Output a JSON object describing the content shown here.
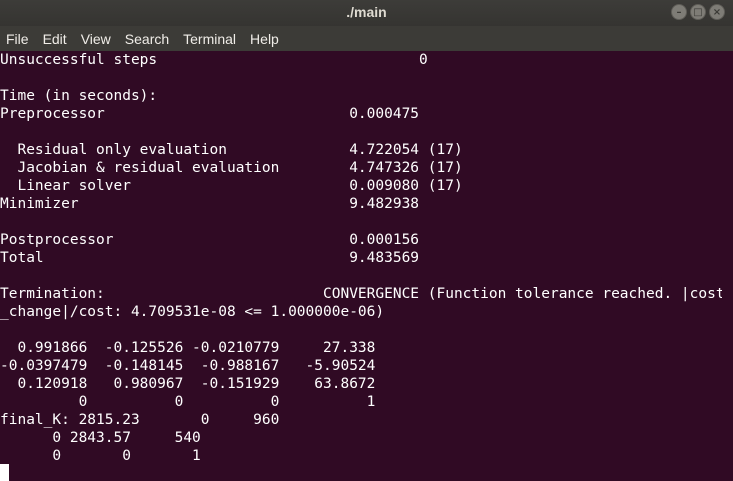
{
  "window": {
    "title": "./main",
    "buttons": {
      "minimize": "–",
      "maximize": "□",
      "close": "×"
    }
  },
  "menu": [
    "File",
    "Edit",
    "View",
    "Search",
    "Terminal",
    "Help"
  ],
  "terminal": {
    "lines": [
      "Unsuccessful steps                              0",
      "",
      "Time (in seconds):",
      "Preprocessor                            0.000475",
      "",
      "  Residual only evaluation              4.722054 (17)",
      "  Jacobian & residual evaluation        4.747326 (17)",
      "  Linear solver                         0.009080 (17)",
      "Minimizer                               9.482938",
      "",
      "Postprocessor                           0.000156",
      "Total                                   9.483569",
      "",
      "Termination:                         CONVERGENCE (Function tolerance reached. |cost",
      "_change|/cost: 4.709531e-08 <= 1.000000e-06)",
      "",
      "  0.991866  -0.125526 -0.0210779     27.338",
      "-0.0397479  -0.148145  -0.988167   -5.90524",
      "  0.120918   0.980967  -0.151929    63.8672",
      "         0          0          0          1",
      "final_K: 2815.23       0     960",
      "      0 2843.57     540",
      "      0       0       1"
    ]
  }
}
